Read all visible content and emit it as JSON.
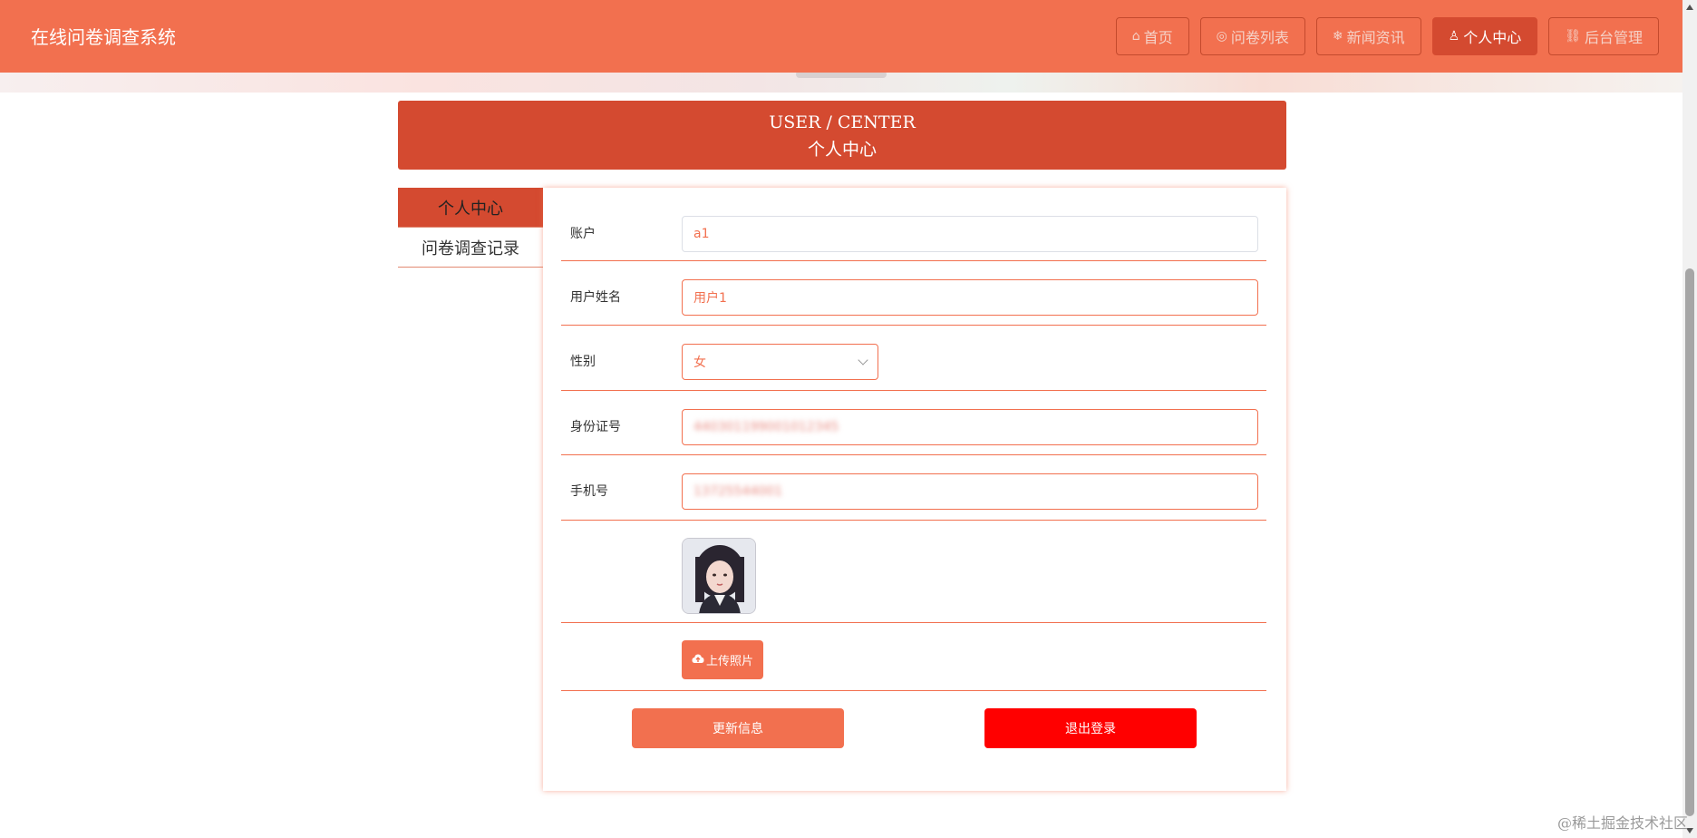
{
  "header": {
    "title": "在线问卷调查系统",
    "nav": [
      {
        "icon": "home-icon",
        "glyph": "⌂",
        "label": "首页"
      },
      {
        "icon": "list-circle-icon",
        "glyph": "◎",
        "label": "问卷列表"
      },
      {
        "icon": "snowflake-icon",
        "glyph": "❄",
        "label": "新闻资讯"
      },
      {
        "icon": "user-icon",
        "glyph": "♙",
        "label": "个人中心",
        "active": true
      },
      {
        "icon": "link-icon",
        "glyph": "⛓",
        "label": "后台管理"
      }
    ]
  },
  "page_title": {
    "en": "USER / CENTER",
    "cn": "个人中心"
  },
  "side_menu": {
    "items": [
      {
        "label": "个人中心",
        "active": true
      },
      {
        "label": "问卷调查记录",
        "active": false
      }
    ]
  },
  "form": {
    "account": {
      "label": "账户",
      "value": "a1"
    },
    "name": {
      "label": "用户姓名",
      "value": "用户1"
    },
    "gender": {
      "label": "性别",
      "value": "女"
    },
    "id_card": {
      "label": "身份证号",
      "value": "440301199001012345"
    },
    "phone": {
      "label": "手机号",
      "value": "13725544001"
    },
    "upload_label": "上传照片",
    "update_label": "更新信息",
    "logout_label": "退出登录"
  },
  "watermark": "@稀土掘金技术社区",
  "colors": {
    "primary": "#f2704f",
    "primary_dark": "#d44a30",
    "danger": "#ff0000"
  }
}
